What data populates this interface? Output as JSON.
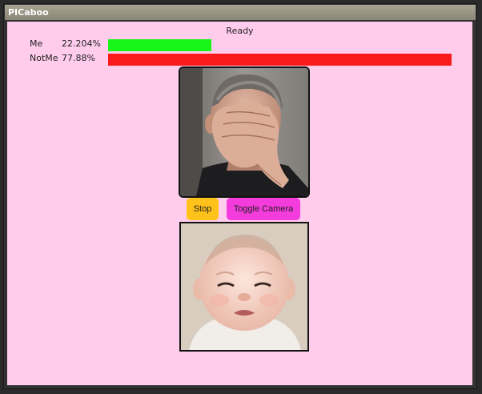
{
  "window": {
    "title": "PICaboo"
  },
  "status": "Ready",
  "scores": [
    {
      "label": "Me",
      "percent": "22.204%",
      "fraction": 0.3,
      "color": "#19f419"
    },
    {
      "label": "NotMe",
      "percent": "77.88%",
      "fraction": 1.0,
      "color": "#f91b1b"
    }
  ],
  "buttons": {
    "stop": {
      "label": "Stop",
      "color": "#ffc21a"
    },
    "toggle": {
      "label": "Toggle Camera",
      "color": "#f43bdc"
    }
  },
  "images": {
    "camera": "man-covering-face-photo",
    "reference": "baby-face-photo"
  }
}
